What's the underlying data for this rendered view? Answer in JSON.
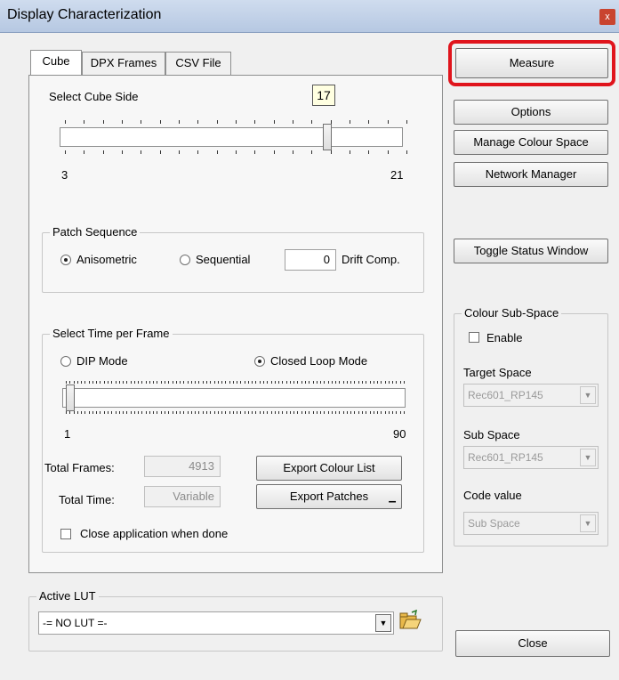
{
  "window": {
    "title": "Display Characterization",
    "close_glyph": "x"
  },
  "tabs": [
    {
      "label": "Cube",
      "active": true
    },
    {
      "label": "DPX Frames",
      "active": false
    },
    {
      "label": "CSV File",
      "active": false
    }
  ],
  "cube": {
    "select_cube_side_label": "Select Cube Side",
    "slider_value_tooltip": "17",
    "slider_min_label": "3",
    "slider_max_label": "21",
    "slider_value": 17,
    "slider_min": 3,
    "slider_max": 21
  },
  "patch_sequence": {
    "group_label": "Patch Sequence",
    "anisometric_label": "Anisometric",
    "anisometric_checked": true,
    "sequential_label": "Sequential",
    "sequential_checked": false,
    "drift_value": "0",
    "drift_label": "Drift Comp."
  },
  "time_per_frame": {
    "group_label": "Select Time per Frame",
    "dip_mode_label": "DIP Mode",
    "dip_mode_checked": false,
    "closed_loop_label": "Closed Loop Mode",
    "closed_loop_checked": true,
    "slider_min_label": "1",
    "slider_max_label": "90",
    "slider_value": 1,
    "slider_min": 1,
    "slider_max": 90
  },
  "totals": {
    "total_frames_label": "Total Frames:",
    "total_frames_value": "4913",
    "total_time_label": "Total Time:",
    "total_time_value": "Variable",
    "export_colour_list_label": "Export Colour List",
    "export_patches_label": "Export Patches",
    "close_when_done_label": "Close application when done",
    "close_when_done_checked": false
  },
  "active_lut": {
    "group_label": "Active LUT",
    "value": "-= NO LUT =-",
    "folder_icon": "folder-open-icon"
  },
  "right_buttons": {
    "measure": "Measure",
    "options": "Options",
    "manage_colour_space": "Manage Colour Space",
    "network_manager": "Network Manager",
    "toggle_status_window": "Toggle Status Window",
    "close": "Close"
  },
  "colour_subspace": {
    "group_label": "Colour Sub-Space",
    "enable_label": "Enable",
    "enable_checked": false,
    "target_space_label": "Target Space",
    "target_space_value": "Rec601_RP145",
    "sub_space_label": "Sub Space",
    "sub_space_value": "Rec601_RP145",
    "code_value_label": "Code value",
    "code_value_value": "Sub Space"
  },
  "colors": {
    "highlight": "#e0141c",
    "title_bar": "#c6d6ec"
  }
}
